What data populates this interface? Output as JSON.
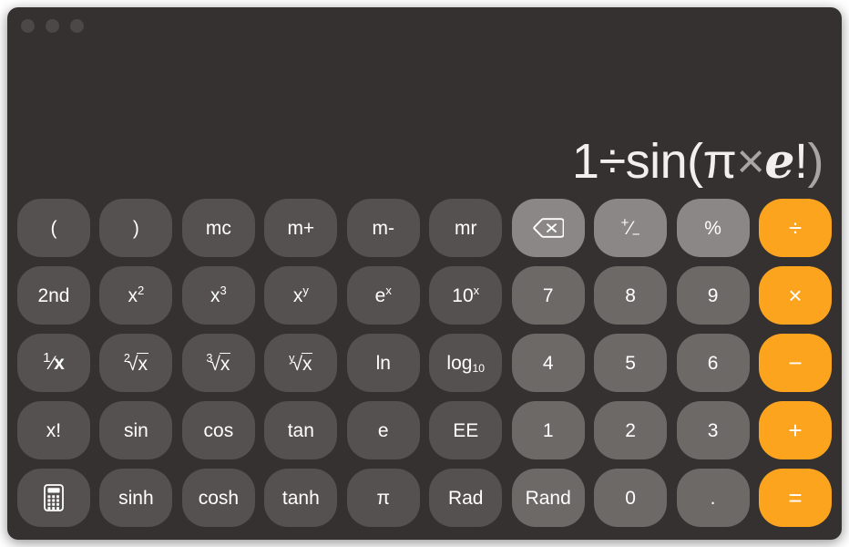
{
  "window": {
    "traffic_lights": [
      {
        "name": "close",
        "color": "#4b4847"
      },
      {
        "name": "minimize",
        "color": "#4b4847"
      },
      {
        "name": "zoom",
        "color": "#4b4847"
      }
    ],
    "background": "#343130"
  },
  "display": {
    "expression": "1÷sin(π×e!)",
    "parts": [
      {
        "text": "1",
        "style": "normal"
      },
      {
        "text": "÷",
        "style": "normal"
      },
      {
        "text": "sin(",
        "style": "normal"
      },
      {
        "text": "π",
        "style": "normal"
      },
      {
        "text": "×",
        "style": "dim"
      },
      {
        "text": "e",
        "style": "euler"
      },
      {
        "text": "!",
        "style": "normal"
      },
      {
        "text": ")",
        "style": "dim"
      }
    ]
  },
  "colors": {
    "background": "#343130",
    "function_key": "#555150",
    "utility_key": "#8b8786",
    "number_key": "#6d6967",
    "operator_key": "#fda41f",
    "text": "#ffffff"
  },
  "keypad": {
    "rows": [
      [
        {
          "label": "(",
          "name": "open-paren",
          "kind": "fn"
        },
        {
          "label": ")",
          "name": "close-paren",
          "kind": "fn"
        },
        {
          "label": "mc",
          "name": "memory-clear",
          "kind": "fn"
        },
        {
          "label": "m+",
          "name": "memory-add",
          "kind": "fn"
        },
        {
          "label": "m-",
          "name": "memory-subtract",
          "kind": "fn"
        },
        {
          "label": "mr",
          "name": "memory-recall",
          "kind": "fn"
        },
        {
          "label": "",
          "name": "delete-icon",
          "kind": "util",
          "icon": "delete"
        },
        {
          "label": "+/-",
          "name": "sign-toggle",
          "kind": "util",
          "render": "plusminus"
        },
        {
          "label": "%",
          "name": "percent",
          "kind": "util"
        },
        {
          "label": "÷",
          "name": "divide",
          "kind": "op"
        }
      ],
      [
        {
          "label": "2nd",
          "name": "second-function",
          "kind": "fn"
        },
        {
          "label": "x2",
          "name": "x-squared",
          "kind": "fn",
          "render": "sup",
          "base": "x",
          "exp": "2"
        },
        {
          "label": "x3",
          "name": "x-cubed",
          "kind": "fn",
          "render": "sup",
          "base": "x",
          "exp": "3"
        },
        {
          "label": "xy",
          "name": "x-to-power-y",
          "kind": "fn",
          "render": "sup",
          "base": "x",
          "exp": "y"
        },
        {
          "label": "ex",
          "name": "e-to-power-x",
          "kind": "fn",
          "render": "sup",
          "base": "e",
          "exp": "x"
        },
        {
          "label": "10x",
          "name": "ten-to-power-x",
          "kind": "fn",
          "render": "sup",
          "base": "10",
          "exp": "x"
        },
        {
          "label": "7",
          "name": "digit-7",
          "kind": "num"
        },
        {
          "label": "8",
          "name": "digit-8",
          "kind": "num"
        },
        {
          "label": "9",
          "name": "digit-9",
          "kind": "num"
        },
        {
          "label": "×",
          "name": "multiply",
          "kind": "op"
        }
      ],
      [
        {
          "label": "1/x",
          "name": "reciprocal",
          "kind": "fn",
          "render": "frac",
          "num": "1",
          "den": "x"
        },
        {
          "label": "2√x",
          "name": "square-root",
          "kind": "fn",
          "render": "root",
          "idx": "2",
          "rad": "x"
        },
        {
          "label": "3√x",
          "name": "cube-root",
          "kind": "fn",
          "render": "root",
          "idx": "3",
          "rad": "x"
        },
        {
          "label": "y√x",
          "name": "nth-root",
          "kind": "fn",
          "render": "root",
          "idx": "y",
          "rad": "x"
        },
        {
          "label": "ln",
          "name": "natural-log",
          "kind": "fn"
        },
        {
          "label": "log10",
          "name": "log-base-10",
          "kind": "fn",
          "render": "sub",
          "base": "log",
          "idx": "10"
        },
        {
          "label": "4",
          "name": "digit-4",
          "kind": "num"
        },
        {
          "label": "5",
          "name": "digit-5",
          "kind": "num"
        },
        {
          "label": "6",
          "name": "digit-6",
          "kind": "num"
        },
        {
          "label": "−",
          "name": "subtract",
          "kind": "op"
        }
      ],
      [
        {
          "label": "x!",
          "name": "factorial",
          "kind": "fn"
        },
        {
          "label": "sin",
          "name": "sine",
          "kind": "fn"
        },
        {
          "label": "cos",
          "name": "cosine",
          "kind": "fn"
        },
        {
          "label": "tan",
          "name": "tangent",
          "kind": "fn"
        },
        {
          "label": "e",
          "name": "euler-constant",
          "kind": "fn"
        },
        {
          "label": "EE",
          "name": "exponent-entry",
          "kind": "fn"
        },
        {
          "label": "1",
          "name": "digit-1",
          "kind": "num"
        },
        {
          "label": "2",
          "name": "digit-2",
          "kind": "num"
        },
        {
          "label": "3",
          "name": "digit-3",
          "kind": "num"
        },
        {
          "label": "+",
          "name": "add",
          "kind": "op"
        }
      ],
      [
        {
          "label": "",
          "name": "calculator-icon",
          "kind": "fn",
          "icon": "calculator"
        },
        {
          "label": "sinh",
          "name": "hyperbolic-sine",
          "kind": "fn"
        },
        {
          "label": "cosh",
          "name": "hyperbolic-cosine",
          "kind": "fn"
        },
        {
          "label": "tanh",
          "name": "hyperbolic-tangent",
          "kind": "fn"
        },
        {
          "label": "π",
          "name": "pi-constant",
          "kind": "fn"
        },
        {
          "label": "Rad",
          "name": "radians-mode",
          "kind": "fn"
        },
        {
          "label": "Rand",
          "name": "random-number",
          "kind": "num"
        },
        {
          "label": "0",
          "name": "digit-0",
          "kind": "num"
        },
        {
          "label": ".",
          "name": "decimal-point",
          "kind": "num"
        },
        {
          "label": "=",
          "name": "equals",
          "kind": "op"
        }
      ]
    ]
  }
}
